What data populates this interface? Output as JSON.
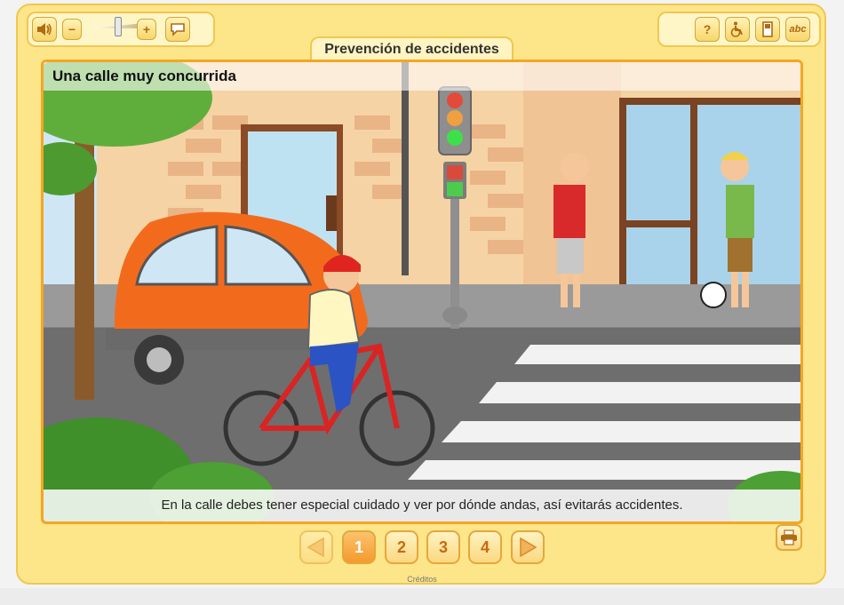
{
  "app": {
    "tab_title": "Prevención de accidentes",
    "credits_label": "Créditos"
  },
  "toolbar_left": {
    "sound_icon": "speaker-icon",
    "minus_label": "−",
    "plus_label": "+",
    "volume_level": 0.5,
    "subtitle_icon": "speech-bubble-icon"
  },
  "toolbar_right": {
    "help_label": "?",
    "accessibility_icon": "wheelchair-icon",
    "fullscreen_icon": "page-icon",
    "glossary_label": "abc"
  },
  "scene": {
    "title": "Una calle muy concurrida",
    "caption": "En la calle debes tener especial cuidado y ver por dónde andas, así evitarás accidentes."
  },
  "pagination": {
    "pages": [
      "1",
      "2",
      "3",
      "4"
    ],
    "current": "1"
  },
  "colors": {
    "frame": "#fde58a",
    "accent": "#f5a623",
    "active_page": "#f59a2e"
  }
}
